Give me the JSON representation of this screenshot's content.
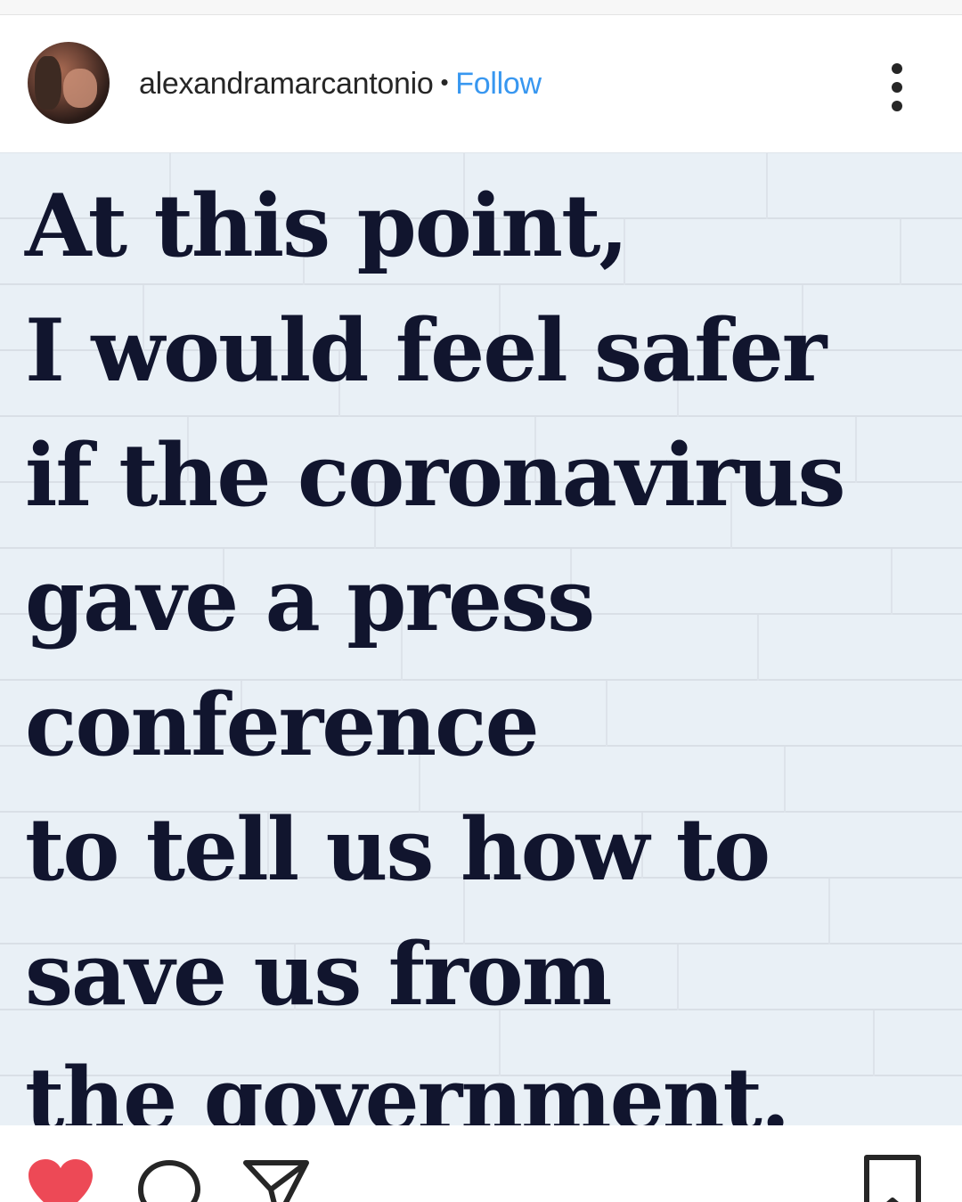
{
  "post": {
    "username": "alexandramarcantonio",
    "separator": "•",
    "follow_label": "Follow",
    "image_lines": [
      "At this point,",
      "I would feel safer",
      "if the coronavirus",
      "gave a press",
      "conference",
      "to tell us how to",
      "save us from",
      "the government."
    ]
  },
  "icons": {
    "more": "more-options-icon",
    "like": "heart-icon",
    "comment": "comment-icon",
    "share": "share-icon",
    "save": "bookmark-icon"
  },
  "colors": {
    "accent": "#3897f0",
    "liked": "#ed4956",
    "text": "#262626",
    "meme_text": "#11152e",
    "meme_background": "#e9f0f6"
  },
  "state": {
    "liked": true
  }
}
